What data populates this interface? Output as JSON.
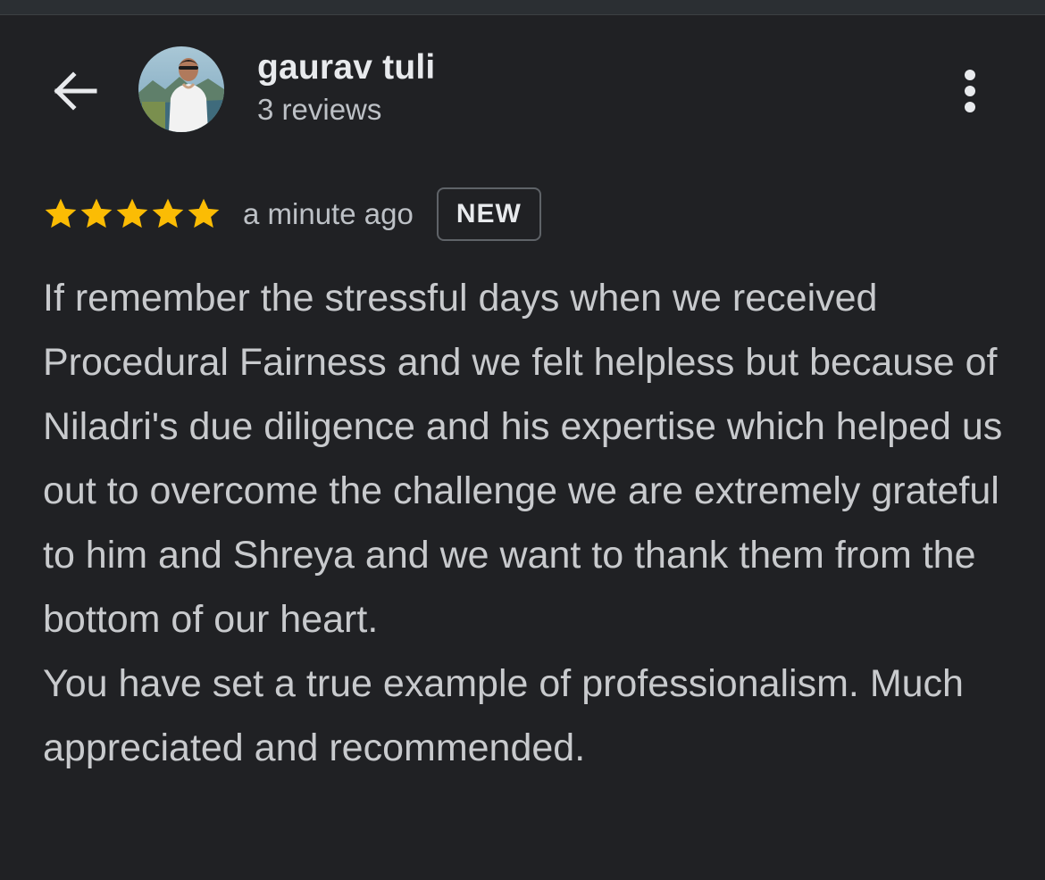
{
  "header": {
    "name": "gaurav tuli",
    "review_count": "3 reviews",
    "back_icon": "arrow-left-icon",
    "more_icon": "more-vert-icon"
  },
  "review": {
    "rating": 5,
    "rating_max": 5,
    "time": "a minute ago",
    "badge": "NEW",
    "paragraphs": [
      "If remember the stressful days when we received Procedural Fairness and we felt helpless but because of Niladri's due diligence and his expertise which helped us out to overcome the challenge we are extremely grateful to him and Shreya and we want to thank them from the bottom of our heart.",
      "You have set a true example of professionalism. Much appreciated and recommended."
    ]
  },
  "colors": {
    "background": "#202124",
    "star": "#fbbc04",
    "primary_text": "#e8eaed",
    "secondary_text": "#bdc1c6"
  }
}
